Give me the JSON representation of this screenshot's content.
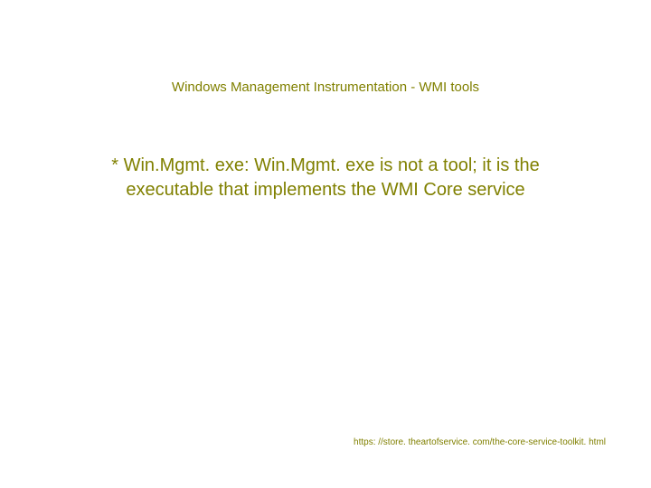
{
  "title": "Windows Management Instrumentation - WMI tools",
  "body": "* Win.Mgmt. exe: Win.Mgmt. exe is not a tool; it is the executable that implements the WMI Core service",
  "footer_url": "https: //store. theartofservice. com/the-core-service-toolkit. html",
  "colors": {
    "text": "#808000",
    "background": "#ffffff"
  }
}
